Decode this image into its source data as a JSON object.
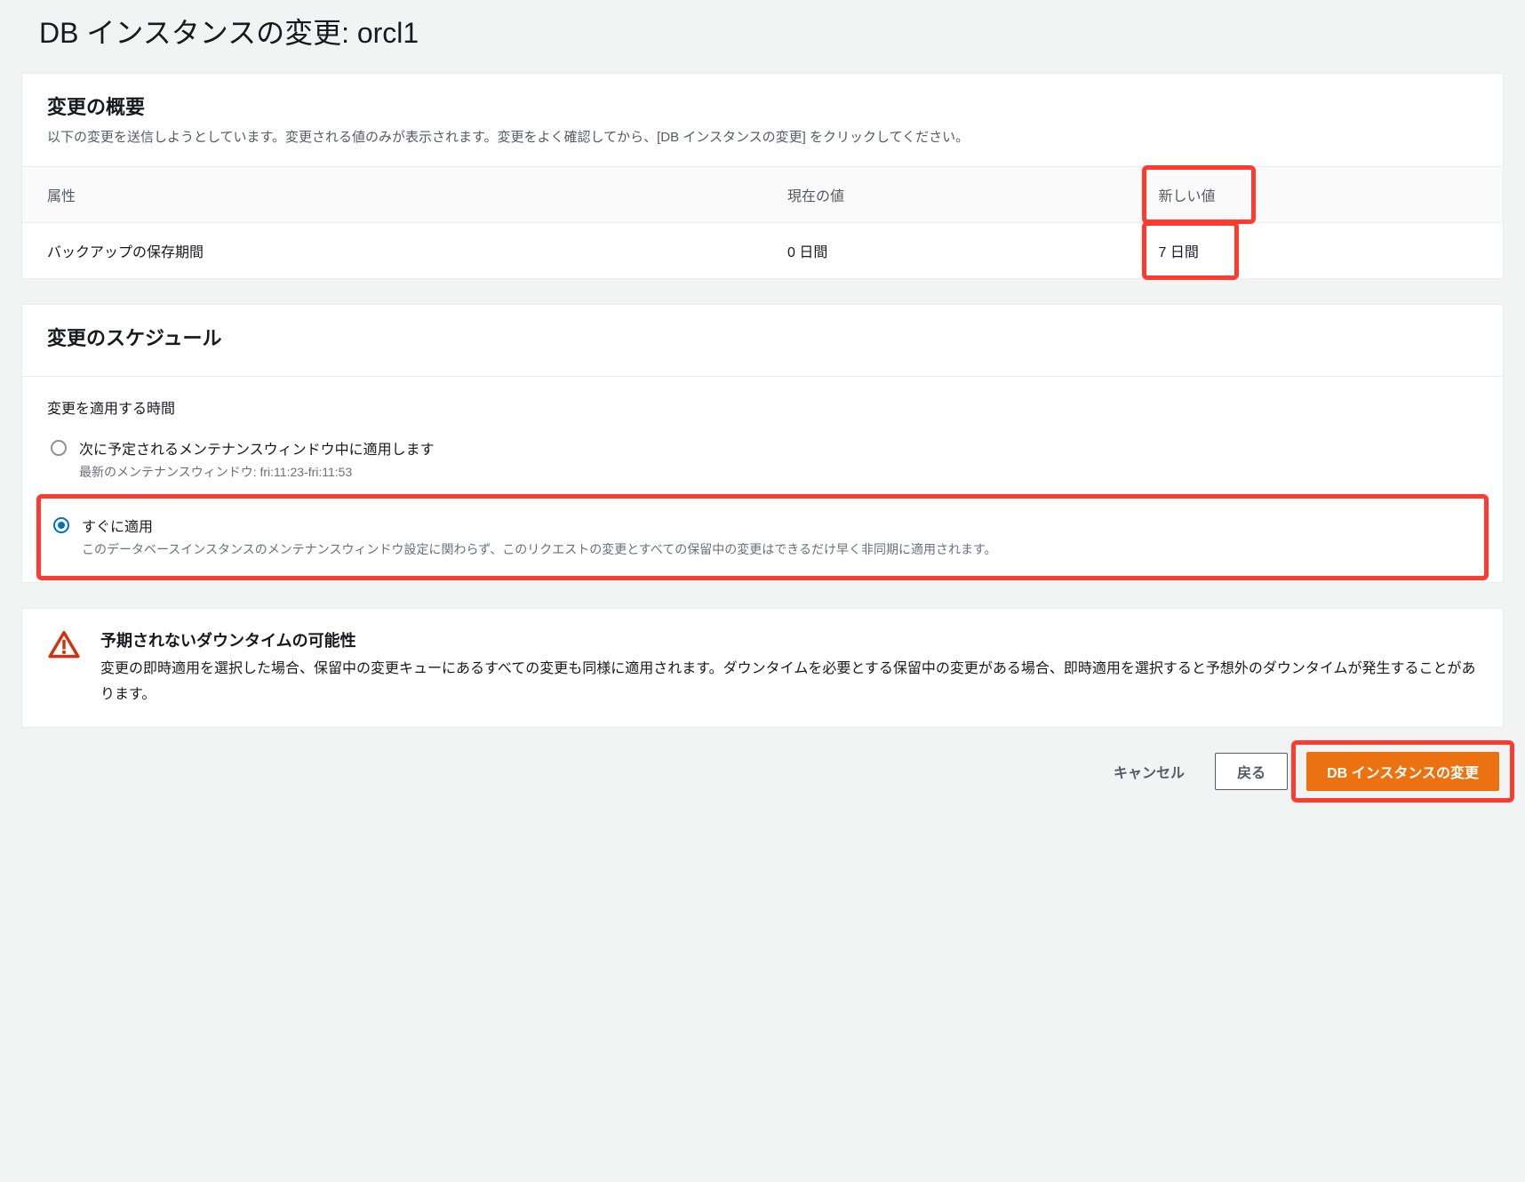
{
  "page": {
    "title": "DB インスタンスの変更: orcl1"
  },
  "summary": {
    "title": "変更の概要",
    "description": "以下の変更を送信しようとしています。変更される値のみが表示されます。変更をよく確認してから、[DB インスタンスの変更] をクリックしてください。",
    "columns": {
      "attr": "属性",
      "current": "現在の値",
      "new": "新しい値"
    },
    "rows": [
      {
        "attr": "バックアップの保存期間",
        "current": "0 日間",
        "new": "7 日間"
      }
    ]
  },
  "schedule": {
    "title": "変更のスケジュール",
    "field_label": "変更を適用する時間",
    "options": {
      "maintenance": {
        "label": "次に予定されるメンテナンスウィンドウ中に適用します",
        "help": "最新のメンテナンスウィンドウ: fri:11:23-fri:11:53"
      },
      "immediate": {
        "label": "すぐに適用",
        "help": "このデータベースインスタンスのメンテナンスウィンドウ設定に関わらず、このリクエストの変更とすべての保留中の変更はできるだけ早く非同期に適用されます。"
      }
    }
  },
  "alert": {
    "title": "予期されないダウンタイムの可能性",
    "text": "変更の即時適用を選択した場合、保留中の変更キューにあるすべての変更も同様に適用されます。ダウンタイムを必要とする保留中の変更がある場合、即時適用を選択すると予想外のダウンタイムが発生することがあります。"
  },
  "actions": {
    "cancel": "キャンセル",
    "back": "戻る",
    "submit": "DB インスタンスの変更"
  }
}
